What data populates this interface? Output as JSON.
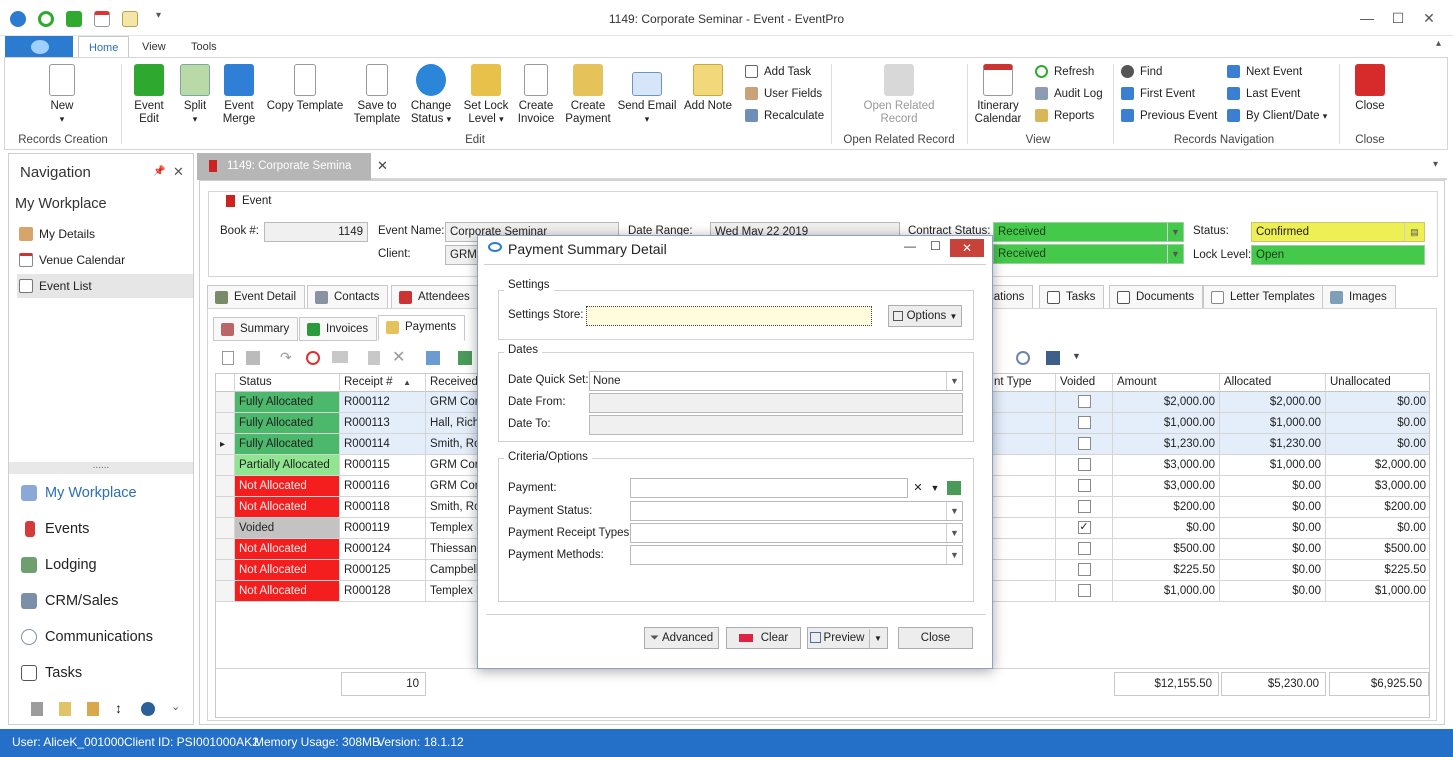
{
  "window": {
    "title": "1149: Corporate Seminar - Event - EventPro"
  },
  "ribbon_tabs": [
    "Home",
    "View",
    "Tools"
  ],
  "ribbon": {
    "records_creation": {
      "new": "New",
      "group": "Records Creation"
    },
    "edit": {
      "buttons": [
        "Event Edit",
        "Split",
        "Event Merge",
        "Copy Template",
        "Save to Template",
        "Change Status",
        "Set Lock Level",
        "Create Invoice",
        "Create Payment",
        "Send Email",
        "Add Note"
      ],
      "small": [
        "Add Task",
        "User Fields",
        "Recalculate"
      ],
      "group": "Edit"
    },
    "open_related": {
      "button": "Open Related Record",
      "group": "Open Related Record"
    },
    "view": {
      "button": "Itinerary Calendar",
      "small": [
        "Refresh",
        "Audit Log",
        "Reports"
      ],
      "group": "View"
    },
    "records_navigation": {
      "col1": [
        "Find",
        "First Event",
        "Previous Event"
      ],
      "col2": [
        "Next Event",
        "Last Event",
        "By Client/Date"
      ],
      "group": "Records Navigation"
    },
    "close": {
      "button": "Close",
      "group": "Close"
    }
  },
  "navigation": {
    "title": "Navigation",
    "section": "My Workplace",
    "items": [
      "My Details",
      "Venue Calendar",
      "Event List"
    ],
    "big_items": [
      "My Workplace",
      "Events",
      "Lodging",
      "CRM/Sales",
      "Communications",
      "Tasks"
    ]
  },
  "doc_tab": "1149: Corporate Semina",
  "event": {
    "section": "Event",
    "book_label": "Book #:",
    "book_value": "1149",
    "event_name_label": "Event Name:",
    "event_name_value": "Corporate Seminar",
    "client_label": "Client:",
    "client_value": "GRM C",
    "date_range_label": "Date Range:",
    "date_range_value": "Wed May 22 2019",
    "contract_status_label": "Contract Status:",
    "contract_status_value": "Received",
    "second_status_value": "Received",
    "status_label": "Status:",
    "status_value": "Confirmed",
    "lock_label": "Lock Level:",
    "lock_value": "Open"
  },
  "event_tabs": [
    "Event Detail",
    "Contacts",
    "Attendees",
    "cations",
    "Tasks",
    "Documents",
    "Letter Templates",
    "Images"
  ],
  "sub_tabs": [
    "Summary",
    "Invoices",
    "Payments"
  ],
  "grid": {
    "columns": [
      "Status",
      "Receipt #",
      "Received",
      "nt Type",
      "Voided",
      "Amount",
      "Allocated",
      "Unallocated"
    ],
    "rows": [
      {
        "status": "Fully Allocated",
        "cls": "st-fa",
        "receipt": "R000112",
        "received": "GRM Corp",
        "voided": false,
        "amount": "$2,000.00",
        "allocated": "$2,000.00",
        "unallocated": "$0.00"
      },
      {
        "status": "Fully Allocated",
        "cls": "st-fa",
        "receipt": "R000113",
        "received": "Hall, Richa",
        "voided": false,
        "amount": "$1,000.00",
        "allocated": "$1,000.00",
        "unallocated": "$0.00"
      },
      {
        "status": "Fully Allocated",
        "cls": "st-fa",
        "receipt": "R000114",
        "received": "Smith, Ron",
        "voided": false,
        "amount": "$1,230.00",
        "allocated": "$1,230.00",
        "unallocated": "$0.00"
      },
      {
        "status": "Partially Allocated",
        "cls": "st-pa",
        "receipt": "R000115",
        "received": "GRM Corp",
        "voided": false,
        "amount": "$3,000.00",
        "allocated": "$1,000.00",
        "unallocated": "$2,000.00"
      },
      {
        "status": "Not Allocated",
        "cls": "st-na",
        "receipt": "R000116",
        "received": "GRM Corp",
        "voided": false,
        "amount": "$3,000.00",
        "allocated": "$0.00",
        "unallocated": "$3,000.00"
      },
      {
        "status": "Not Allocated",
        "cls": "st-na",
        "receipt": "R000118",
        "received": "Smith, Ro",
        "voided": false,
        "amount": "$200.00",
        "allocated": "$0.00",
        "unallocated": "$200.00"
      },
      {
        "status": "Voided",
        "cls": "st-vo",
        "receipt": "R000119",
        "received": "Templex F",
        "voided": true,
        "amount": "$0.00",
        "allocated": "$0.00",
        "unallocated": "$0.00"
      },
      {
        "status": "Not Allocated",
        "cls": "st-na",
        "receipt": "R000124",
        "received": "Thiessan,",
        "voided": false,
        "amount": "$500.00",
        "allocated": "$0.00",
        "unallocated": "$500.00"
      },
      {
        "status": "Not Allocated",
        "cls": "st-na",
        "receipt": "R000125",
        "received": "Campbell,",
        "voided": false,
        "amount": "$225.50",
        "allocated": "$0.00",
        "unallocated": "$225.50"
      },
      {
        "status": "Not Allocated",
        "cls": "st-na",
        "receipt": "R000128",
        "received": "Templex F",
        "voided": false,
        "amount": "$1,000.00",
        "allocated": "$0.00",
        "unallocated": "$1,000.00"
      }
    ],
    "footer": {
      "count": "10",
      "amount": "$12,155.50",
      "allocated": "$5,230.00",
      "unallocated": "$6,925.50"
    }
  },
  "dialog": {
    "title": "Payment Summary Detail",
    "settings_group": "Settings",
    "settings_store_label": "Settings Store:",
    "options_button": "Options",
    "dates_group": "Dates",
    "date_quick_set_label": "Date Quick Set:",
    "date_quick_set_value": "None",
    "date_from_label": "Date From:",
    "date_to_label": "Date To:",
    "criteria_group": "Criteria/Options",
    "payment_label": "Payment:",
    "payment_status_label": "Payment Status:",
    "payment_receipt_types_label": "Payment Receipt Types:",
    "payment_methods_label": "Payment Methods:",
    "advanced_button": "Advanced",
    "clear_button": "Clear",
    "preview_button": "Preview",
    "close_button": "Close"
  },
  "statusbar": {
    "user": "User: AliceK_001000",
    "client": "Client ID: PSI001000AK2",
    "memory": "Memory Usage: 308MB",
    "version": "Version: 18.1.12"
  }
}
